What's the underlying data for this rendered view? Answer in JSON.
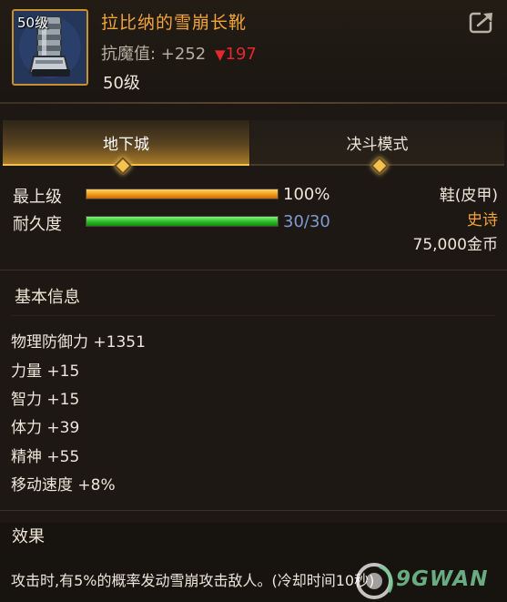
{
  "item": {
    "level_badge": "50级",
    "name": "拉比纳的雪崩长靴",
    "magic_resist_label": "抗魔值: +252",
    "magic_resist_change": "197",
    "required_level": "50级",
    "icon": "avalanche-boots-icon"
  },
  "tabs": [
    {
      "label": "地下城",
      "active": true
    },
    {
      "label": "决斗模式",
      "active": false
    }
  ],
  "stats": {
    "max_upgrade": {
      "label": "最上级",
      "value": "100%",
      "fill": 1.0
    },
    "durability": {
      "label": "耐久度",
      "value": "30/30",
      "fill": 1.0
    }
  },
  "item_type": {
    "category": "鞋(皮甲)",
    "rarity": "史诗",
    "price": "75,000金币"
  },
  "basic_info": {
    "title": "基本信息",
    "attributes": [
      "物理防御力 +1351",
      "力量 +15",
      "智力 +15",
      "体力 +39",
      "精神 +55",
      "移动速度 +8%"
    ]
  },
  "effect": {
    "title": "效果",
    "text": "攻击时,有5%的概率发动雪崩攻击敌人。(冷却时间10秒)"
  },
  "watermark": {
    "text": "9GWAN"
  },
  "colors": {
    "accent_orange": "#f3a43a",
    "rarity_epic": "#f3a43a",
    "durability_value": "#7f9bd0",
    "decrease_red": "#e5282b"
  }
}
